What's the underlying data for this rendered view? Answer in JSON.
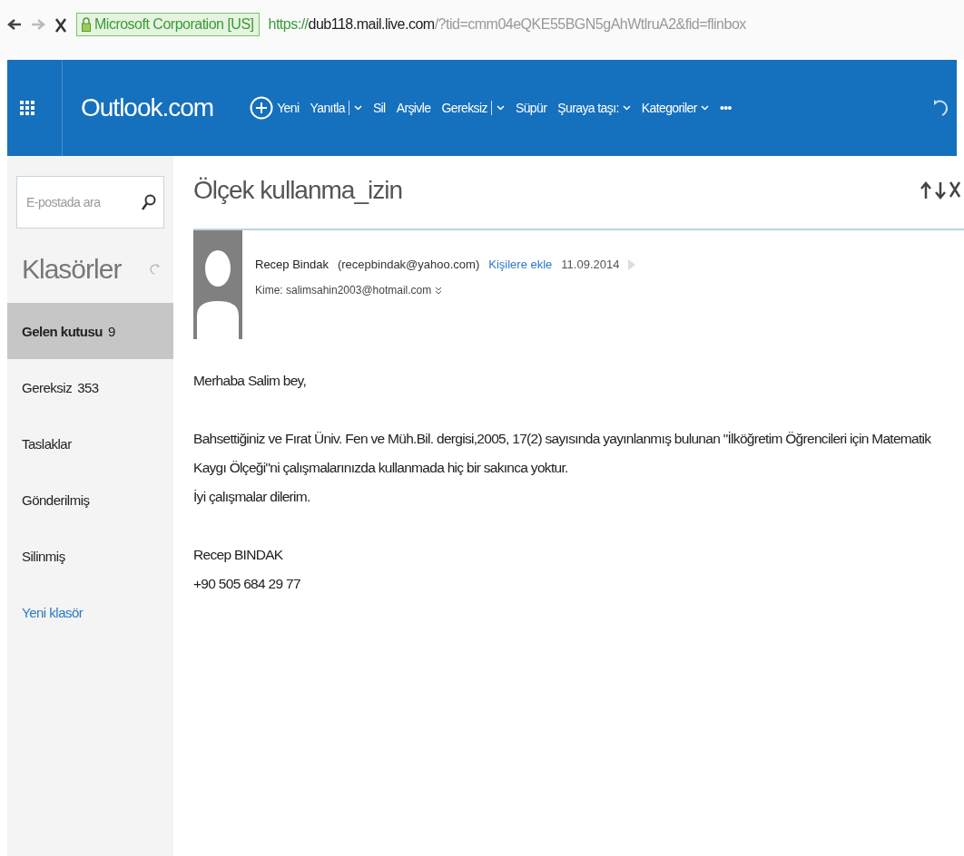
{
  "browser": {
    "certificate": "Microsoft Corporation [US]",
    "url_scheme": "https://",
    "url_host": "dub118.mail.live.com",
    "url_rest": "/?tid=cmm04eQKE55BGN5gAhWtlruA2&fid=flinbox"
  },
  "app": {
    "brand": "Outlook.com"
  },
  "toolbar": [
    {
      "label": "Yeni",
      "kind": "new"
    },
    {
      "label": "Yanıtla",
      "kind": "split"
    },
    {
      "label": "Sil",
      "kind": "plain"
    },
    {
      "label": "Arşivle",
      "kind": "plain"
    },
    {
      "label": "Gereksiz",
      "kind": "split"
    },
    {
      "label": "Süpür",
      "kind": "plain"
    },
    {
      "label": "Şuraya taşı:",
      "kind": "menu"
    },
    {
      "label": "Kategoriler",
      "kind": "menu"
    },
    {
      "label": "•••",
      "kind": "plain"
    }
  ],
  "search": {
    "placeholder": "E-postada ara"
  },
  "folders_title": "Klasörler",
  "folders": [
    {
      "name": "Gelen kutusu",
      "count": "9",
      "selected": true,
      "kind": "folder"
    },
    {
      "name": "Gereksiz",
      "count": "353",
      "selected": false,
      "kind": "folder"
    },
    {
      "name": "Taslaklar",
      "selected": false,
      "kind": "folder"
    },
    {
      "name": "Gönderilmiş",
      "selected": false,
      "kind": "folder"
    },
    {
      "name": "Silinmiş",
      "selected": false,
      "kind": "folder"
    },
    {
      "name": "Yeni klasör",
      "selected": false,
      "kind": "link"
    }
  ],
  "message": {
    "subject": "Ölçek kullanma_izin",
    "sender": "Recep Bindak",
    "sender_email": "(recepbindak@yahoo.com)",
    "add_contact": "Kişilere ekle",
    "date": "11.09.2014",
    "to": "Kime: salimsahin2003@hotmail.com",
    "body": [
      [
        "Merhaba Salim bey,"
      ],
      [
        "Bahsettiğiniz ve Fırat Üniv. Fen ve Müh.Bil. dergisi,2005, 17(2) sayısında yayınlanmış bulunan \"İlköğretim Öğrencileri için Matematik Kaygı Ölçeği\"ni çalışmalarınızda kullanmada hiç bir sakınca yoktur.",
        "İyi çalışmalar dilerim."
      ],
      [
        "Recep BINDAK",
        "+90 505 684 29 77"
      ]
    ]
  }
}
